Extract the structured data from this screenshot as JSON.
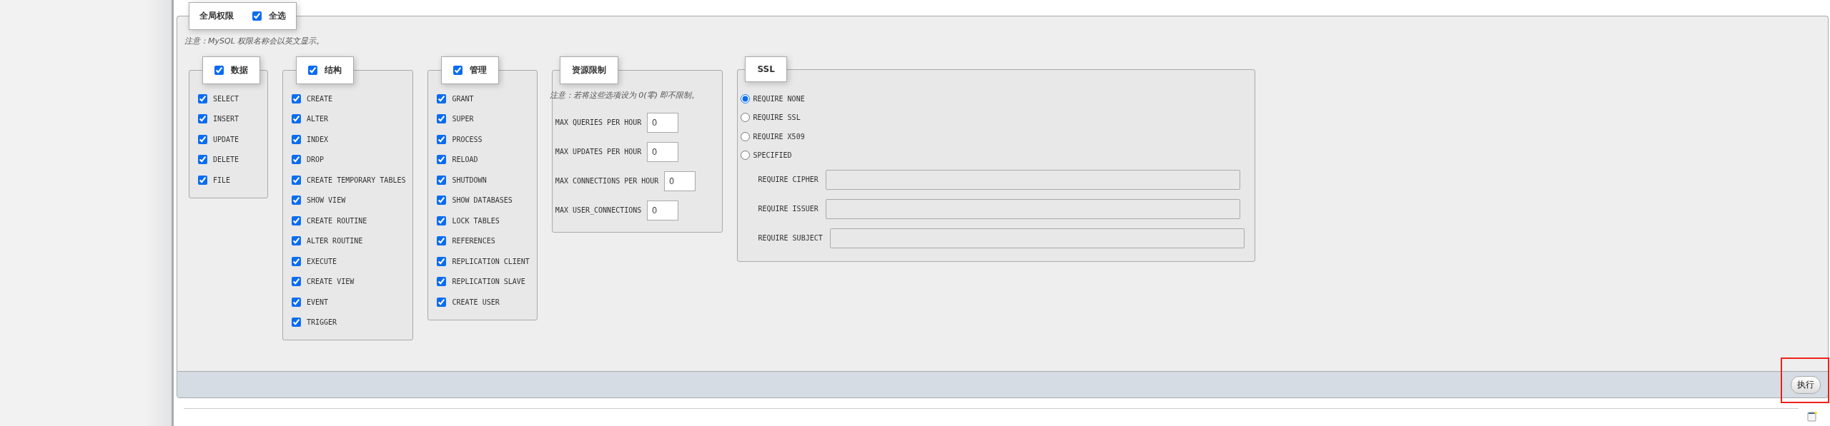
{
  "global": {
    "legend": "全局权限",
    "select_all": {
      "label": "全选",
      "checked": true
    }
  },
  "note": "注意：MySQL 权限名称会以英文显示。",
  "groups": [
    {
      "legend": "数据",
      "checked": true,
      "items": [
        {
          "label": "SELECT",
          "checked": true
        },
        {
          "label": "INSERT",
          "checked": true
        },
        {
          "label": "UPDATE",
          "checked": true
        },
        {
          "label": "DELETE",
          "checked": true
        },
        {
          "label": "FILE",
          "checked": true
        }
      ]
    },
    {
      "legend": "结构",
      "checked": true,
      "items": [
        {
          "label": "CREATE",
          "checked": true
        },
        {
          "label": "ALTER",
          "checked": true
        },
        {
          "label": "INDEX",
          "checked": true
        },
        {
          "label": "DROP",
          "checked": true
        },
        {
          "label": "CREATE TEMPORARY TABLES",
          "checked": true
        },
        {
          "label": "SHOW VIEW",
          "checked": true
        },
        {
          "label": "CREATE ROUTINE",
          "checked": true
        },
        {
          "label": "ALTER ROUTINE",
          "checked": true
        },
        {
          "label": "EXECUTE",
          "checked": true
        },
        {
          "label": "CREATE VIEW",
          "checked": true
        },
        {
          "label": "EVENT",
          "checked": true
        },
        {
          "label": "TRIGGER",
          "checked": true
        }
      ]
    },
    {
      "legend": "管理",
      "checked": true,
      "items": [
        {
          "label": "GRANT",
          "checked": true
        },
        {
          "label": "SUPER",
          "checked": true
        },
        {
          "label": "PROCESS",
          "checked": true
        },
        {
          "label": "RELOAD",
          "checked": true
        },
        {
          "label": "SHUTDOWN",
          "checked": true
        },
        {
          "label": "SHOW DATABASES",
          "checked": true
        },
        {
          "label": "LOCK TABLES",
          "checked": true
        },
        {
          "label": "REFERENCES",
          "checked": true
        },
        {
          "label": "REPLICATION CLIENT",
          "checked": true
        },
        {
          "label": "REPLICATION SLAVE",
          "checked": true
        },
        {
          "label": "CREATE USER",
          "checked": true
        }
      ]
    }
  ],
  "resource_limits": {
    "legend": "资源限制",
    "note": "注意：若将这些选项设为 0(零) 即不限制。",
    "fields": [
      {
        "label": "MAX QUERIES PER HOUR",
        "value": "0"
      },
      {
        "label": "MAX UPDATES PER HOUR",
        "value": "0"
      },
      {
        "label": "MAX CONNECTIONS PER HOUR",
        "value": "0"
      },
      {
        "label": "MAX USER_CONNECTIONS",
        "value": "0"
      }
    ]
  },
  "ssl": {
    "legend": "SSL",
    "options": [
      {
        "label": "REQUIRE NONE",
        "selected": true
      },
      {
        "label": "REQUIRE SSL",
        "selected": false
      },
      {
        "label": "REQUIRE X509",
        "selected": false
      },
      {
        "label": "SPECIFIED",
        "selected": false
      }
    ],
    "fields": [
      {
        "label": "REQUIRE CIPHER",
        "disabled": true
      },
      {
        "label": "REQUIRE ISSUER",
        "disabled": true
      },
      {
        "label": "REQUIRE SUBJECT",
        "disabled": true
      }
    ]
  },
  "submit": {
    "label": "执行",
    "highlighted": true
  }
}
